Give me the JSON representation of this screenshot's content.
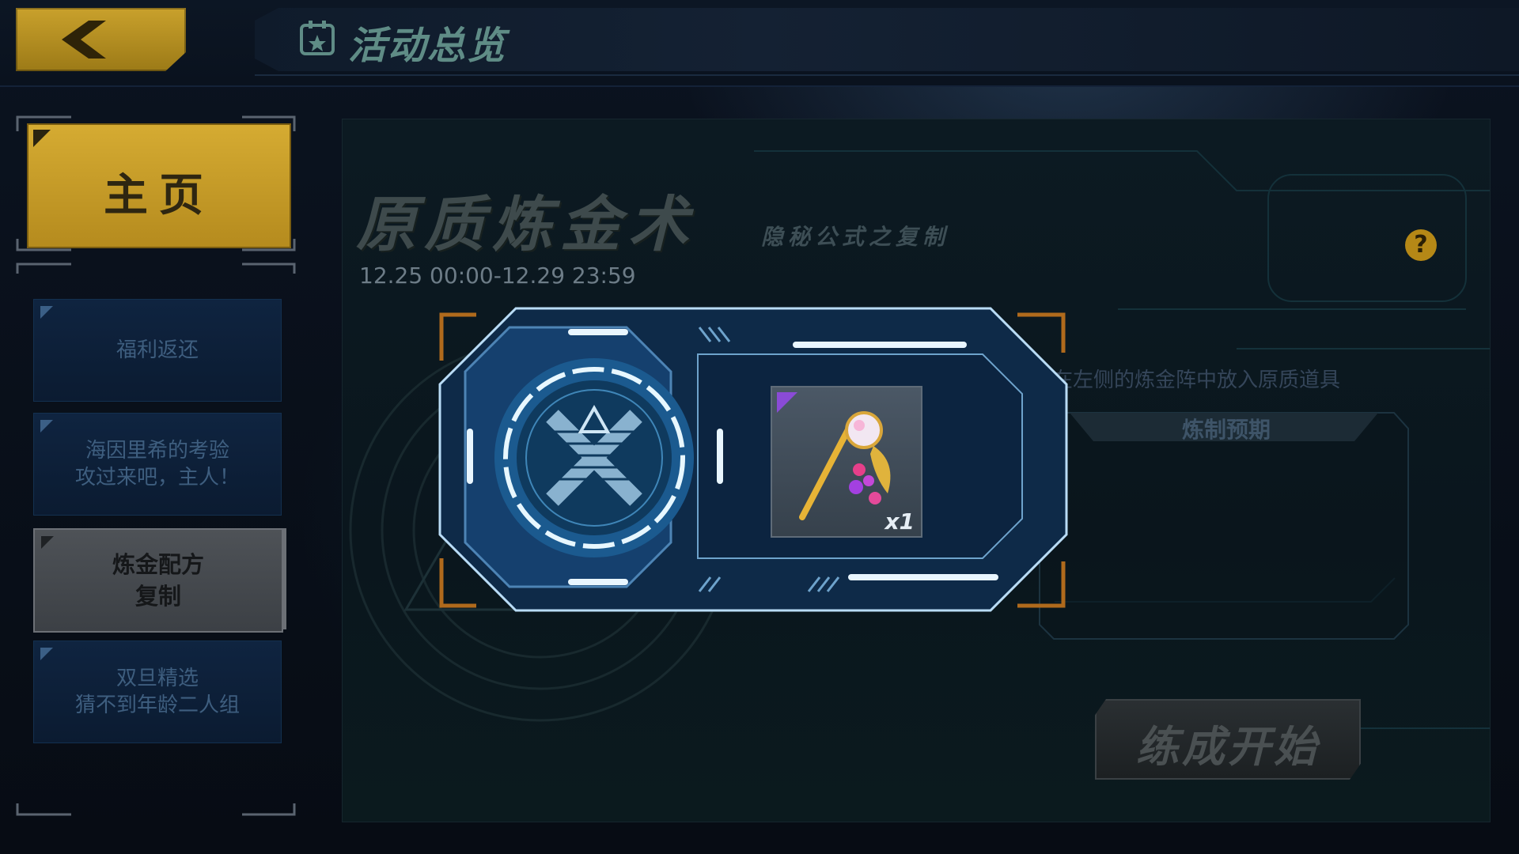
{
  "header": {
    "title": "活动总览",
    "back_icon": "chevron-left-icon",
    "title_icon": "calendar-icon"
  },
  "sidebar": {
    "home_label": "主页",
    "items": [
      {
        "label": "福利返还",
        "active": false
      },
      {
        "label": "海因里希的考验\n攻过来吧，主人！",
        "active": false
      },
      {
        "label": "炼金配方\n复制",
        "active": true
      },
      {
        "label": "双旦精选\n猜不到年龄二人组",
        "active": false
      }
    ]
  },
  "event": {
    "title": "原质炼金术",
    "subtitle": "隐秘公式之复制",
    "date_range": "12.25 00:00-12.29 23:59",
    "help_symbol": "?",
    "instruction": "在左侧的炼金阵中放入原质道具",
    "forecast_label": "炼制预期",
    "start_button": "练成开始"
  },
  "alchemy": {
    "slot_icon": "alchemy-circle-icon",
    "item": {
      "icon": "ornate-scepter-icon",
      "rarity_color": "#8a4bd6",
      "quantity": "x1"
    }
  },
  "colors": {
    "accent_gold": "#c9a12c",
    "panel_blue": "#0f2440",
    "glow_cyan": "#9fd8ff"
  }
}
